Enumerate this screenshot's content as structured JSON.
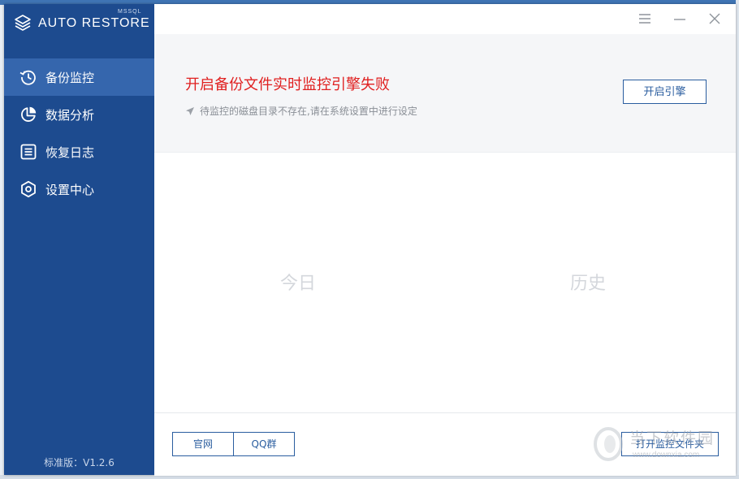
{
  "app": {
    "name": "AUTO RESTORE",
    "brand_sup": "MSSQL",
    "version": "标准版：V1.2.6"
  },
  "sidebar": {
    "items": [
      {
        "label": "备份监控",
        "icon": "history-icon",
        "active": true
      },
      {
        "label": "数据分析",
        "icon": "pie-chart-icon",
        "active": false
      },
      {
        "label": "恢复日志",
        "icon": "list-icon",
        "active": false
      },
      {
        "label": "设置中心",
        "icon": "settings-icon",
        "active": false
      }
    ]
  },
  "window_controls": [
    "menu-icon",
    "minimize-icon",
    "close-icon"
  ],
  "banner": {
    "title": "开启备份文件实时监控引擎失败",
    "subtitle": "待监控的磁盘目录不存在,请在系统设置中进行设定",
    "button": "开启引擎"
  },
  "content": {
    "today": "今日",
    "history": "历史"
  },
  "footer": {
    "website": "官网",
    "qq_group": "QQ群",
    "open_folder": "打开监控文件夹"
  },
  "watermark": {
    "text": "当下软件园",
    "url": "www.downxia.com"
  },
  "colors": {
    "sidebar_bg": "#1d4b8f",
    "sidebar_active": "#3566ad",
    "accent": "#2a5d9f",
    "error": "#e02020"
  }
}
